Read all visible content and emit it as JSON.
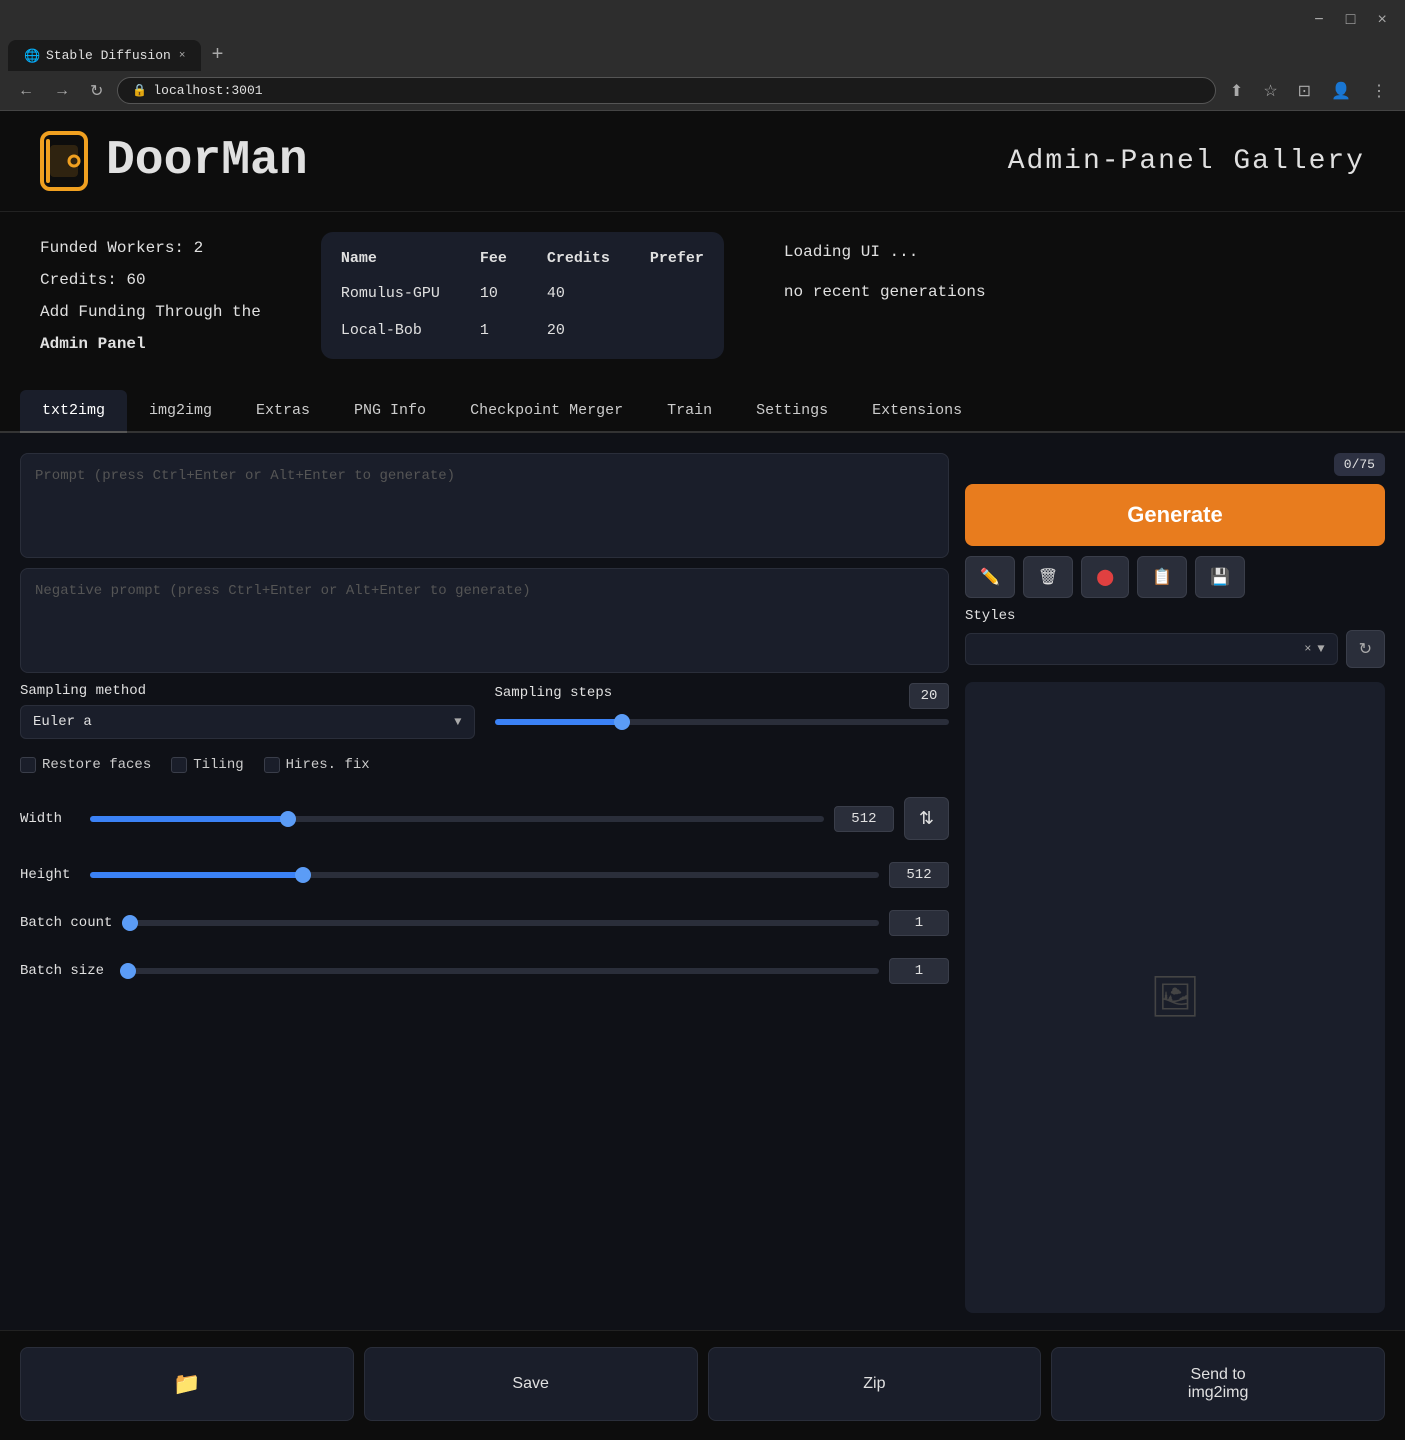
{
  "browser": {
    "tab_favicon": "🌐",
    "tab_title": "Stable Diffusion",
    "tab_close": "×",
    "new_tab": "+",
    "url": "localhost:3001",
    "window_controls": [
      "⌄",
      "−",
      "□",
      "×"
    ]
  },
  "header": {
    "logo_text": "DoorMan",
    "page_title": "Admin-Panel  Gallery"
  },
  "info_panel": {
    "funded_workers_label": "Funded Workers: 2",
    "credits_label": "Credits: 60",
    "add_funding_line1": "Add Funding Through the",
    "add_funding_bold": "Admin Panel",
    "table_headers": [
      "Name",
      "Fee",
      "Credits",
      "Prefer"
    ],
    "table_rows": [
      {
        "name": "Romulus-GPU",
        "fee": "10",
        "credits": "40",
        "prefer": ""
      },
      {
        "name": "Local-Bob",
        "fee": "1",
        "credits": "20",
        "prefer": ""
      }
    ],
    "status_line1": "Loading UI ...",
    "status_line2": "no recent generations"
  },
  "tabs": [
    {
      "label": "txt2img",
      "active": true
    },
    {
      "label": "img2img",
      "active": false
    },
    {
      "label": "Extras",
      "active": false
    },
    {
      "label": "PNG Info",
      "active": false
    },
    {
      "label": "Checkpoint Merger",
      "active": false
    },
    {
      "label": "Train",
      "active": false
    },
    {
      "label": "Settings",
      "active": false
    },
    {
      "label": "Extensions",
      "active": false
    }
  ],
  "prompt": {
    "placeholder": "Prompt (press Ctrl+Enter or Alt+Enter to generate)",
    "negative_placeholder": "Negative prompt (press Ctrl+Enter or Alt+Enter to generate)"
  },
  "token_count": "0/75",
  "generate_button": "Generate",
  "action_icons": [
    {
      "icon": "✏️",
      "name": "edit-icon"
    },
    {
      "icon": "🗑️",
      "name": "trash-icon"
    },
    {
      "icon": "🔴",
      "name": "record-icon"
    },
    {
      "icon": "📋",
      "name": "clipboard-icon"
    },
    {
      "icon": "💾",
      "name": "save-icon"
    }
  ],
  "styles": {
    "label": "Styles",
    "placeholder": "",
    "clear": "×",
    "dropdown": "▼",
    "refresh_icon": "↻"
  },
  "sampling": {
    "method_label": "Sampling method",
    "method_value": "Euler a",
    "steps_label": "Sampling steps",
    "steps_value": "20",
    "slider_fill_pct": "28"
  },
  "checkboxes": [
    {
      "label": "Restore faces",
      "checked": false
    },
    {
      "label": "Tiling",
      "checked": false
    },
    {
      "label": "Hires. fix",
      "checked": false
    }
  ],
  "width": {
    "label": "Width",
    "value": "512",
    "slider_pct": "27"
  },
  "height": {
    "label": "Height",
    "value": "512",
    "slider_pct": "27"
  },
  "batch_count": {
    "label": "Batch count",
    "value": "1",
    "slider_pct": "2"
  },
  "batch_size": {
    "label": "Batch size",
    "value": "1",
    "slider_pct": "2"
  },
  "bottom_buttons": [
    {
      "label": "📁",
      "name": "folder-button"
    },
    {
      "label": "Save",
      "name": "save-button"
    },
    {
      "label": "Zip",
      "name": "zip-button"
    },
    {
      "label": "Send to\nimg2img",
      "name": "send-to-img2img-button"
    }
  ]
}
